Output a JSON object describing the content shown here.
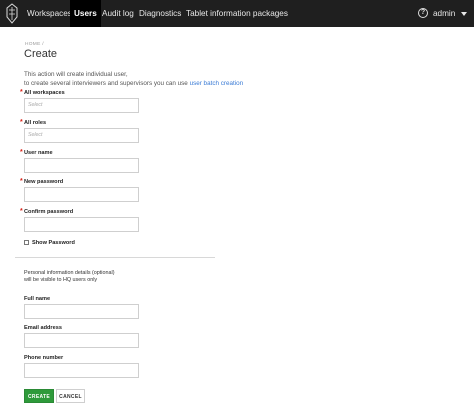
{
  "navbar": {
    "items": [
      {
        "label": "Workspaces"
      },
      {
        "label": "Users",
        "active": true
      },
      {
        "label": "Audit log"
      },
      {
        "label": "Diagnostics"
      },
      {
        "label": "Tablet information packages"
      }
    ],
    "user_label": "admin",
    "help_glyph": "?"
  },
  "breadcrumb": {
    "home": "HOME"
  },
  "page": {
    "title": "Create",
    "intro_line1": "This action will create individual user,",
    "intro_line2_prefix": "to create several interviewers and supervisors you can use ",
    "intro_link": "user batch creation"
  },
  "form": {
    "workspaces": {
      "label": "All workspaces",
      "placeholder": "Select"
    },
    "roles": {
      "label": "All roles",
      "placeholder": "Select"
    },
    "username": {
      "label": "User name"
    },
    "new_password": {
      "label": "New password"
    },
    "confirm_password": {
      "label": "Confirm password"
    },
    "show_password": {
      "label": "Show Password"
    },
    "personal_note_line1": "Personal information details (optional)",
    "personal_note_line2": "will be visible to HQ users only",
    "full_name": {
      "label": "Full name"
    },
    "email": {
      "label": "Email address"
    },
    "phone": {
      "label": "Phone number"
    },
    "create_label": "CREATE",
    "cancel_label": "CANCEL"
  },
  "colors": {
    "navbar_bg": "#1f1f1f",
    "accent_link": "#3a7bd5",
    "required": "#d9261c",
    "create_button": "#2e9a3a"
  }
}
